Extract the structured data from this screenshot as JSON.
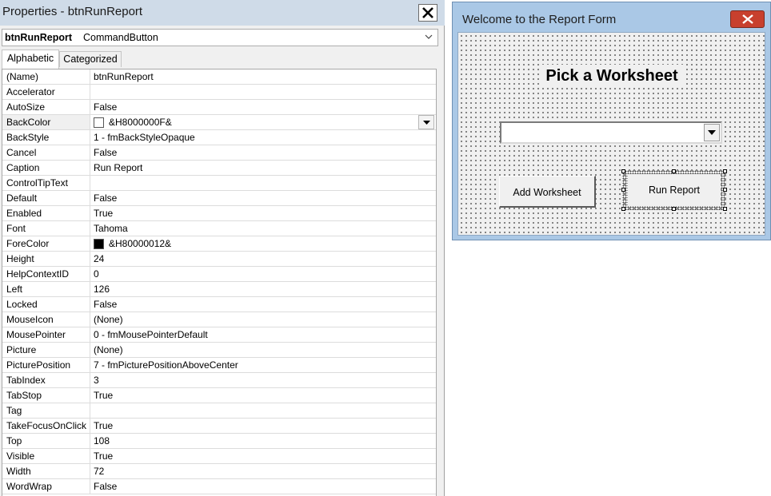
{
  "properties_window": {
    "title": "Properties - btnRunReport",
    "object_name": "btnRunReport",
    "object_type": "CommandButton",
    "tabs": [
      {
        "label": "Alphabetic"
      },
      {
        "label": "Categorized"
      }
    ],
    "rows": [
      {
        "name": "(Name)",
        "value": "btnRunReport"
      },
      {
        "name": "Accelerator",
        "value": ""
      },
      {
        "name": "AutoSize",
        "value": "False"
      },
      {
        "name": "BackColor",
        "value": "&H8000000F&",
        "swatch": "#ffffff"
      },
      {
        "name": "BackStyle",
        "value": "1 - fmBackStyleOpaque"
      },
      {
        "name": "Cancel",
        "value": "False"
      },
      {
        "name": "Caption",
        "value": "Run Report"
      },
      {
        "name": "ControlTipText",
        "value": ""
      },
      {
        "name": "Default",
        "value": "False"
      },
      {
        "name": "Enabled",
        "value": "True"
      },
      {
        "name": "Font",
        "value": "Tahoma"
      },
      {
        "name": "ForeColor",
        "value": "&H80000012&",
        "swatch": "#000000"
      },
      {
        "name": "Height",
        "value": "24"
      },
      {
        "name": "HelpContextID",
        "value": "0"
      },
      {
        "name": "Left",
        "value": "126"
      },
      {
        "name": "Locked",
        "value": "False"
      },
      {
        "name": "MouseIcon",
        "value": "(None)"
      },
      {
        "name": "MousePointer",
        "value": "0 - fmMousePointerDefault"
      },
      {
        "name": "Picture",
        "value": "(None)"
      },
      {
        "name": "PicturePosition",
        "value": "7 - fmPicturePositionAboveCenter"
      },
      {
        "name": "TabIndex",
        "value": "3"
      },
      {
        "name": "TabStop",
        "value": "True"
      },
      {
        "name": "Tag",
        "value": ""
      },
      {
        "name": "TakeFocusOnClick",
        "value": "True"
      },
      {
        "name": "Top",
        "value": "108"
      },
      {
        "name": "Visible",
        "value": "True"
      },
      {
        "name": "Width",
        "value": "72"
      },
      {
        "name": "WordWrap",
        "value": "False"
      }
    ]
  },
  "user_form": {
    "title": "Welcome to the Report Form",
    "heading": "Pick a Worksheet",
    "worksheet_combo_value": "",
    "add_button_label": "Add Worksheet",
    "run_button_label": "Run Report"
  },
  "colors": {
    "form_frame": "#aac8e6",
    "close_button": "#c8402e",
    "props_titlebar": "#cfdbe8"
  }
}
